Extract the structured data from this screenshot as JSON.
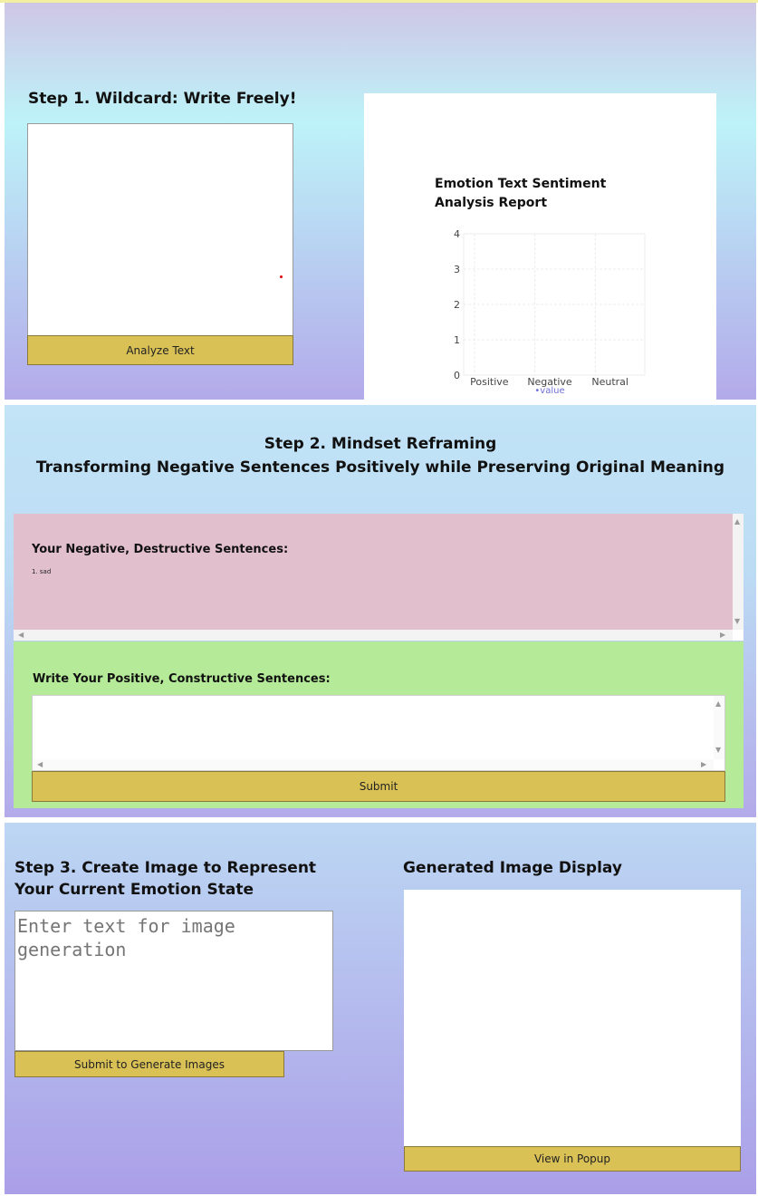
{
  "top_strip_text": "... ... ... ... ... ...",
  "step1": {
    "title": "Step 1. Wildcard: Write Freely!",
    "textarea_value": "",
    "analyze_label": "Analyze Text"
  },
  "report": {
    "title": "Emotion Text Sentiment Analysis Report",
    "legend": "value"
  },
  "chart_data": {
    "type": "bar",
    "title": "Emotion Text Sentiment Analysis Report",
    "categories": [
      "Positive",
      "Negative",
      "Neutral"
    ],
    "series": [
      {
        "name": "value",
        "values": [
          0,
          0,
          0
        ]
      }
    ],
    "ylim": [
      0,
      4
    ],
    "yticks": [
      0,
      1,
      2,
      3,
      4
    ],
    "grid": true,
    "legend_position": "bottom"
  },
  "step2": {
    "title_line1": "Step 2. Mindset Reframing",
    "title_line2": "Transforming Negative Sentences Positively while Preserving Original Meaning",
    "negative_heading": "Your Negative, Destructive Sentences:",
    "negative_items": [
      "1. sad"
    ],
    "positive_heading": "Write Your Positive, Constructive Sentences:",
    "positive_value": "",
    "submit_label": "Submit"
  },
  "step3": {
    "title_line1": "Step 3. Create Image to Represent",
    "title_line2": "Your Current Emotion State",
    "placeholder": "Enter text for image generation",
    "submit_label": "Submit to Generate Images",
    "display_title": "Generated Image Display",
    "popup_label": "View in Popup"
  },
  "colors": {
    "button": "#d9c156",
    "negative_bg": "#e2bfcc",
    "positive_bg": "#b5eb98",
    "legend": "#6f6fd8"
  }
}
